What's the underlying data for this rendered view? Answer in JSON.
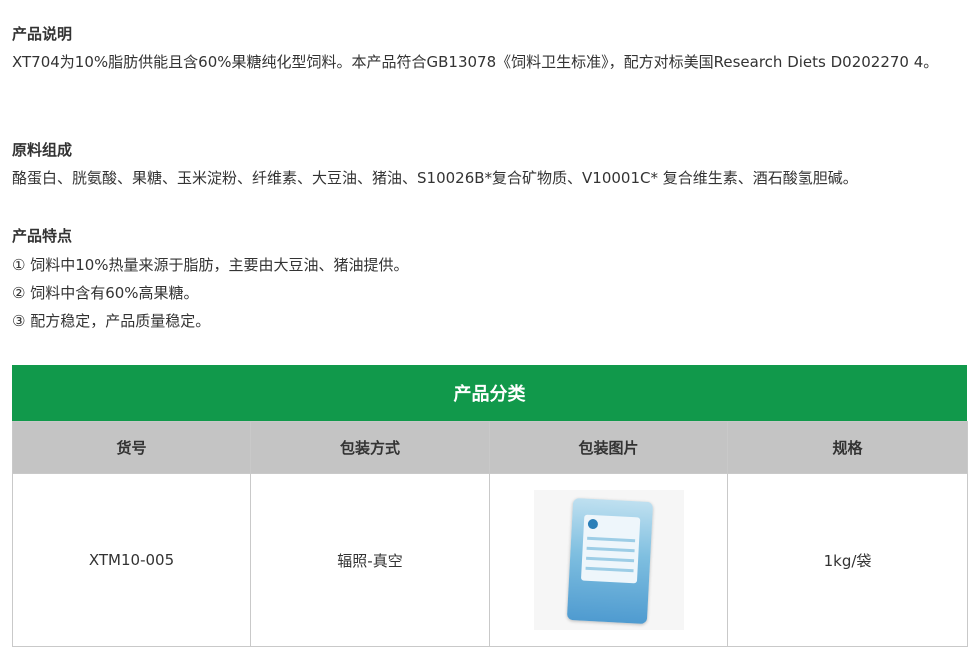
{
  "sections": {
    "description": {
      "title": "产品说明",
      "text": "XT704为10%脂肪供能且含60%果糖纯化型饲料。本产品符合GB13078《饲料卫生标准》，配方对标美国Research Diets D0202270 4。"
    },
    "ingredients": {
      "title": "原料组成",
      "text": "酪蛋白、胱氨酸、果糖、玉米淀粉、纤维素、大豆油、猪油、S10026B*复合矿物质、V10001C* 复合维生素、酒石酸氢胆碱。"
    },
    "features": {
      "title": "产品特点",
      "items": [
        "① 饲料中10%热量来源于脂肪，主要由大豆油、猪油提供。",
        "② 饲料中含有60%高果糖。",
        "③ 配方稳定，产品质量稳定。"
      ]
    }
  },
  "table": {
    "title": "产品分类",
    "accent_color": "#11994b",
    "headers": [
      "货号",
      "包装方式",
      "包装图片",
      "规格"
    ],
    "rows": [
      {
        "sku": "XTM10-005",
        "packaging": "辐照-真空",
        "image": "feed-bag-image",
        "spec": "1kg/袋"
      }
    ]
  }
}
